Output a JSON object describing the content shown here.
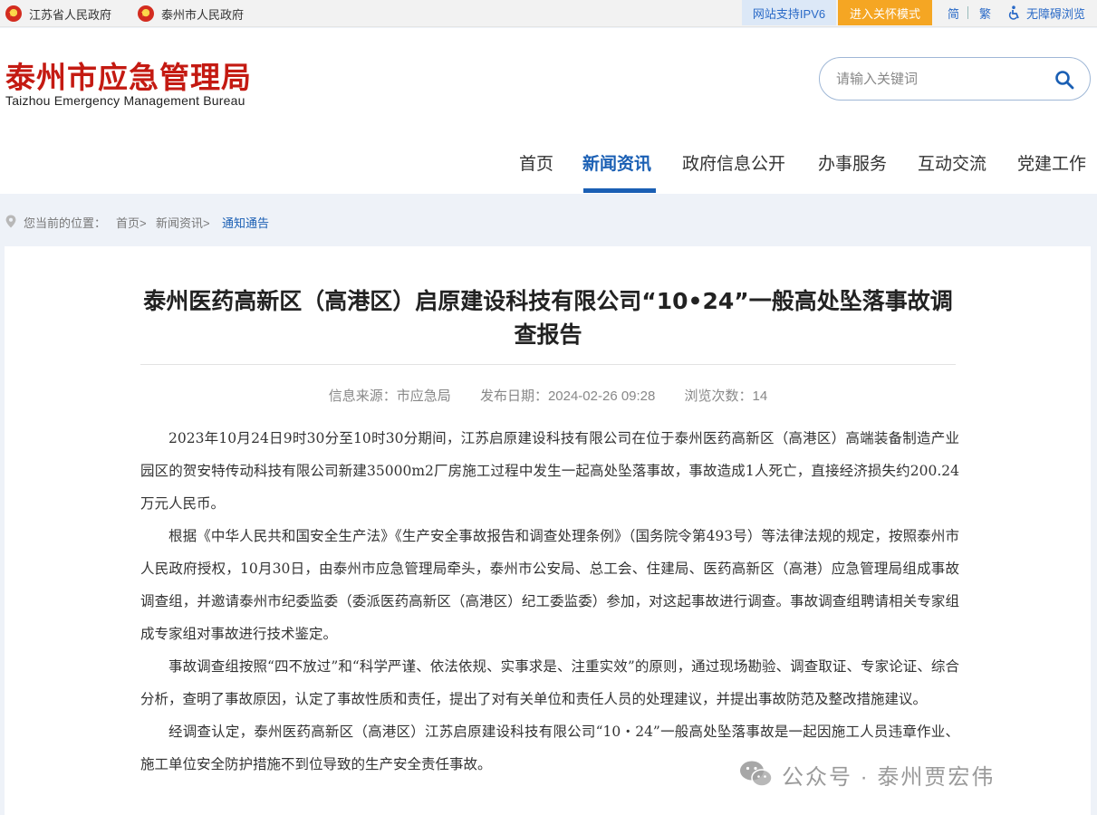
{
  "topbar": {
    "gov_links": [
      "江苏省人民政府",
      "泰州市人民政府"
    ],
    "ipv6": "网站支持IPV6",
    "care_mode": "进入关怀模式",
    "simplified": "简",
    "traditional": "繁",
    "accessibility": "无障碍浏览"
  },
  "header": {
    "logo_cn": "泰州市应急管理局",
    "logo_en": "Taizhou Emergency Management Bureau",
    "search_placeholder": "请输入关键词"
  },
  "nav": {
    "items": [
      "首页",
      "新闻资讯",
      "政府信息公开",
      "办事服务",
      "互动交流",
      "党建工作"
    ],
    "active": "新闻资讯"
  },
  "breadcrumb": {
    "prefix": "您当前的位置：",
    "home": "首页>",
    "news": "新闻资讯>",
    "current": "通知通告"
  },
  "article": {
    "title": "泰州医药高新区（高港区）启原建设科技有限公司“10•24”一般高处坠落事故调查报告",
    "source": "信息来源：市应急局",
    "date": "发布日期：2024-02-26 09:28",
    "views": "浏览次数：14",
    "paragraphs": [
      "2023年10月24日9时30分至10时30分期间，江苏启原建设科技有限公司在位于泰州医药高新区（高港区）高端装备制造产业园区的贺安特传动科技有限公司新建35000m2厂房施工过程中发生一起高处坠落事故，事故造成1人死亡，直接经济损失约200.24万元人民币。",
      "根据《中华人民共和国安全生产法》《生产安全事故报告和调查处理条例》（国务院令第493号）等法律法规的规定，按照泰州市人民政府授权，10月30日，由泰州市应急管理局牵头，泰州市公安局、总工会、住建局、医药高新区（高港）应急管理局组成事故调查组，并邀请泰州市纪委监委（委派医药高新区（高港区）纪工委监委）参加，对这起事故进行调查。事故调查组聘请相关专家组成专家组对事故进行技术鉴定。",
      "事故调查组按照“四不放过”和“科学严谨、依法依规、实事求是、注重实效”的原则，通过现场勘验、调查取证、专家论证、综合分析，查明了事故原因，认定了事故性质和责任，提出了对有关单位和责任人员的处理建议，并提出事故防范及整改措施建议。",
      "经调查认定，泰州医药高新区（高港区）江苏启原建设科技有限公司“10・24”一般高处坠落事故是一起因施工人员违章作业、施工单位安全防护措施不到位导致的生产安全责任事故。"
    ]
  },
  "watermark": {
    "text": "公众号 · 泰州贾宏伟"
  }
}
